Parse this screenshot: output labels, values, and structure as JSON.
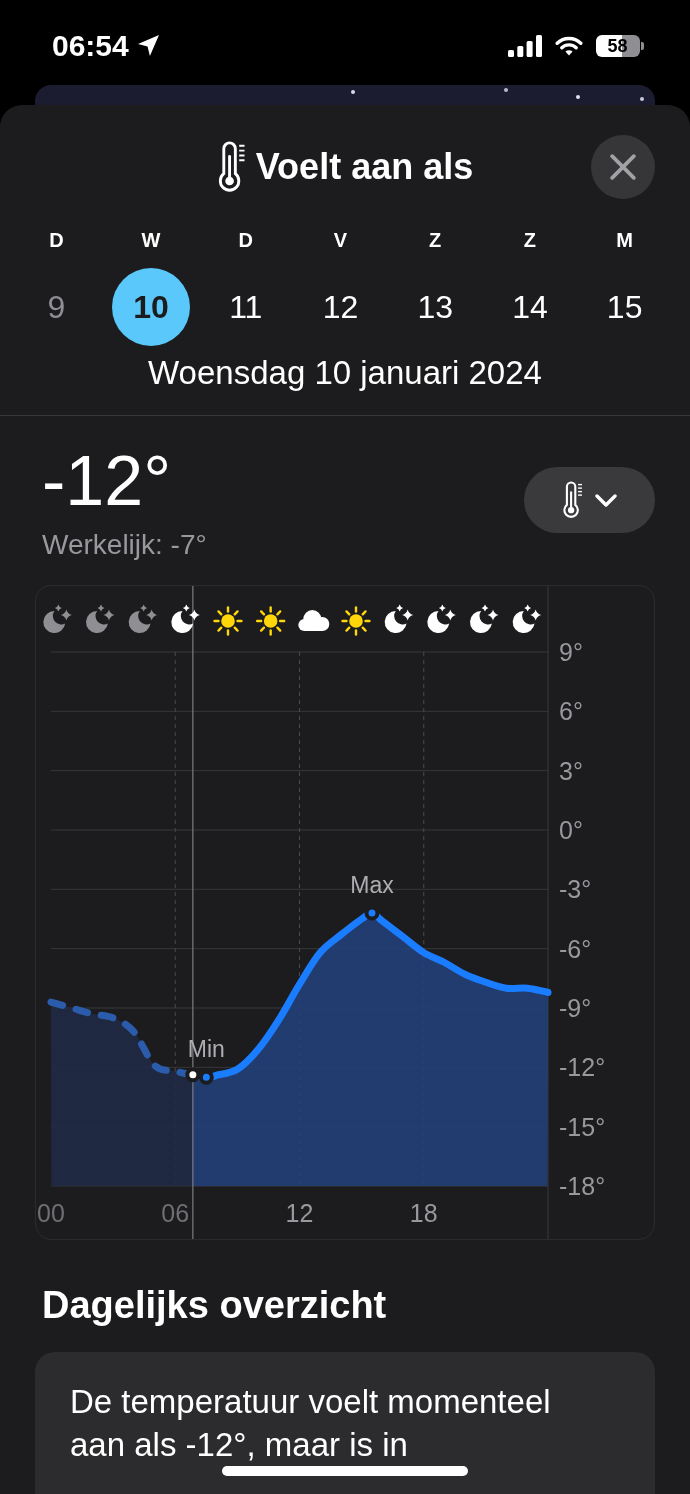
{
  "status_bar": {
    "time": "06:54",
    "battery": "58"
  },
  "header": {
    "title": "Voelt aan als"
  },
  "days": [
    {
      "weekday": "D",
      "day": "9",
      "selected": false,
      "past": true
    },
    {
      "weekday": "W",
      "day": "10",
      "selected": true,
      "past": false
    },
    {
      "weekday": "D",
      "day": "11",
      "selected": false,
      "past": false
    },
    {
      "weekday": "V",
      "day": "12",
      "selected": false,
      "past": false
    },
    {
      "weekday": "Z",
      "day": "13",
      "selected": false,
      "past": false
    },
    {
      "weekday": "Z",
      "day": "14",
      "selected": false,
      "past": false
    },
    {
      "weekday": "M",
      "day": "15",
      "selected": false,
      "past": false
    }
  ],
  "date_label": "Woensdag 10 januari 2024",
  "current": {
    "value": "-12°",
    "actual": "Werkelijk: -7°"
  },
  "chart": {
    "chart_data": {
      "type": "area",
      "x": [
        0,
        1,
        2,
        3,
        4,
        5,
        6,
        7.5,
        8,
        9,
        10,
        11,
        12,
        13,
        14,
        15,
        15.5,
        16,
        17,
        18,
        19,
        20,
        21,
        22,
        23,
        24
      ],
      "series": [
        {
          "color": "#1a7cff",
          "values": [
            -8.7,
            -9.0,
            -9.3,
            -9.5,
            -10.2,
            -11.9,
            -12.2,
            -12.5,
            -12.4,
            -12.1,
            -11.1,
            -9.6,
            -7.8,
            -6.2,
            -5.3,
            -4.5,
            -4.2,
            -4.6,
            -5.4,
            -6.2,
            -6.7,
            -7.3,
            -7.7,
            -8.0,
            -8.0,
            -8.2
          ]
        }
      ],
      "xlim": [
        0,
        24
      ],
      "ylim": [
        -18,
        9
      ],
      "xticks": [
        {
          "value": 0,
          "label": "00"
        },
        {
          "value": 6,
          "label": "06"
        },
        {
          "value": 12,
          "label": "12"
        },
        {
          "value": 18,
          "label": "18"
        }
      ],
      "yticks": [
        {
          "value": 9,
          "label": "9°"
        },
        {
          "value": 6,
          "label": "6°"
        },
        {
          "value": 3,
          "label": "3°"
        },
        {
          "value": 0,
          "label": "0°"
        },
        {
          "value": -3,
          "label": "-3°"
        },
        {
          "value": -6,
          "label": "-6°"
        },
        {
          "value": -9,
          "label": "-9°"
        },
        {
          "value": -12,
          "label": "-12°"
        },
        {
          "value": -15,
          "label": "-15°"
        },
        {
          "value": -18,
          "label": "-18°"
        }
      ],
      "grid": true,
      "ref_lines": [
        {
          "axis": "x",
          "value": 6.85
        }
      ],
      "annotations": [
        {
          "text": "Min",
          "x": 7.5,
          "y": -12.5
        },
        {
          "text": "Max",
          "x": 15.5,
          "y": -4.2
        }
      ]
    }
  },
  "summary": {
    "heading": "Dagelijks overzicht",
    "text": "De temperatuur voelt momenteel aan als -12°, maar is in"
  }
}
